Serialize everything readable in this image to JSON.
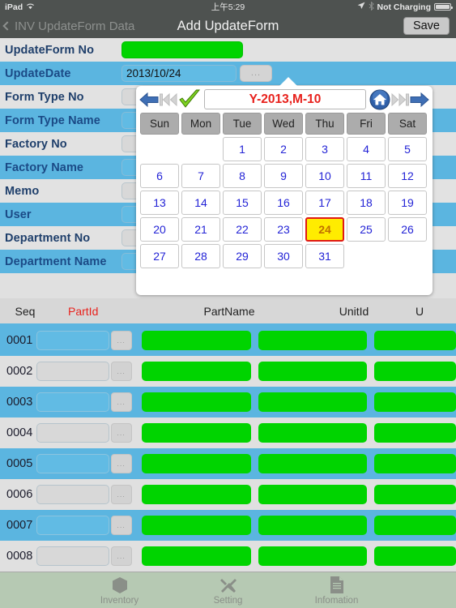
{
  "status_bar": {
    "device": "iPad",
    "wifi_icon": "wifi-icon",
    "time": "上午5:29",
    "location_icon": "location-arrow-icon",
    "bluetooth_icon": "bluetooth-icon",
    "charge_status": "Not Charging",
    "battery_icon": "battery-icon"
  },
  "nav_bar": {
    "back_label": "INV UpdateForm Data",
    "back_icon": "chevron-left-icon",
    "title": "Add UpdateForm",
    "save_label": "Save"
  },
  "form": {
    "rows": [
      {
        "label": "UpdateForm No",
        "field": "green",
        "value": ""
      },
      {
        "label": "UpdateDate",
        "field": "text-dots",
        "value": "2013/10/24"
      },
      {
        "label": "Form Type No",
        "field": "text-dots",
        "value": ""
      },
      {
        "label": "Form Type Name",
        "field": "green",
        "value": ""
      },
      {
        "label": "Factory No",
        "field": "text-dots",
        "value": ""
      },
      {
        "label": "Factory Name",
        "field": "green",
        "value": ""
      },
      {
        "label": "Memo",
        "field": "text-dots",
        "value": ""
      },
      {
        "label": "User",
        "field": "text-dots",
        "value": ""
      },
      {
        "label": "Department No",
        "field": "text-dots",
        "value": ""
      },
      {
        "label": "Department Name",
        "field": "green",
        "value": ""
      }
    ],
    "dots_label": "..."
  },
  "calendar": {
    "title": "Y-2013,M-10",
    "nav": {
      "prev_icon": "blue-left-arrow-icon",
      "prev_year_icon": "double-left-arrow-icon",
      "confirm_icon": "green-check-icon",
      "home_icon": "home-icon",
      "next_year_icon": "double-right-arrow-icon",
      "next_icon": "blue-right-arrow-icon"
    },
    "weekdays": [
      "Sun",
      "Mon",
      "Tue",
      "Wed",
      "Thu",
      "Fri",
      "Sat"
    ],
    "weeks": [
      [
        "",
        "",
        "1",
        "2",
        "3",
        "4",
        "5"
      ],
      [
        "6",
        "7",
        "8",
        "9",
        "10",
        "11",
        "12"
      ],
      [
        "13",
        "14",
        "15",
        "16",
        "17",
        "18",
        "19"
      ],
      [
        "20",
        "21",
        "22",
        "23",
        "24",
        "25",
        "26"
      ],
      [
        "27",
        "28",
        "29",
        "30",
        "31",
        "",
        ""
      ]
    ],
    "selected_day": "24",
    "selected_bg": "#ffec00",
    "selected_border": "#e01a14",
    "title_color": "#e8221d"
  },
  "table": {
    "headers": {
      "seq": "Seq",
      "part_id": "PartId",
      "part_name": "PartName",
      "unit_id": "UnitId",
      "more": "U"
    },
    "part_id_color": "#e8221d",
    "dots_label": "...",
    "rows": [
      {
        "seq": "0001"
      },
      {
        "seq": "0002"
      },
      {
        "seq": "0003"
      },
      {
        "seq": "0004"
      },
      {
        "seq": "0005"
      },
      {
        "seq": "0006"
      },
      {
        "seq": "0007"
      },
      {
        "seq": "0008"
      }
    ]
  },
  "tab_bar": {
    "tabs": [
      {
        "label": "Inventory",
        "icon": "box-icon"
      },
      {
        "label": "Setting",
        "icon": "tools-icon"
      },
      {
        "label": "Infomation",
        "icon": "document-icon"
      }
    ]
  },
  "colors": {
    "row_blue": "#5bb5e0",
    "row_gray": "#e0e0e0",
    "field_green": "#00d400",
    "chrome": "#4e5250"
  }
}
